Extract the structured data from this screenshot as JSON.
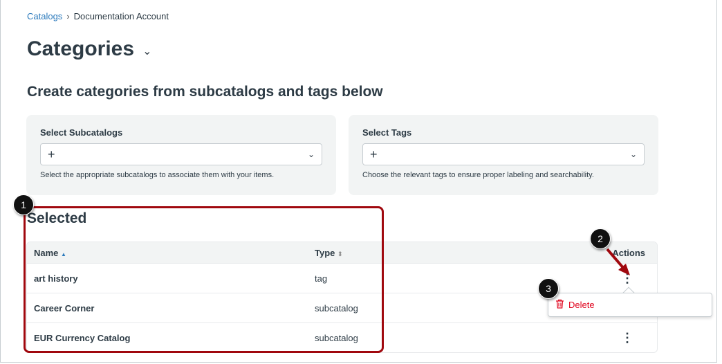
{
  "breadcrumb": {
    "root": "Catalogs",
    "current": "Documentation Account"
  },
  "page_title": "Categories",
  "subtitle": "Create categories from subcatalogs and tags below",
  "subcatalogs": {
    "label": "Select Subcatalogs",
    "value": "+",
    "hint": "Select the appropriate subcatalogs to associate them with your items."
  },
  "tags": {
    "label": "Select Tags",
    "value": "+",
    "hint": "Choose the relevant tags to ensure proper labeling and searchability."
  },
  "selected": {
    "heading": "Selected",
    "columns": {
      "name": "Name",
      "type": "Type",
      "actions": "Actions"
    },
    "rows": [
      {
        "name": "art history",
        "type": "tag"
      },
      {
        "name": "Career Corner",
        "type": "subcatalog"
      },
      {
        "name": "EUR Currency Catalog",
        "type": "subcatalog"
      }
    ]
  },
  "menu": {
    "delete": "Delete"
  },
  "badges": [
    "1",
    "2",
    "3"
  ],
  "colors": {
    "accent": "#2b7abc",
    "annotation": "#a0080e",
    "danger": "#e0061f"
  }
}
